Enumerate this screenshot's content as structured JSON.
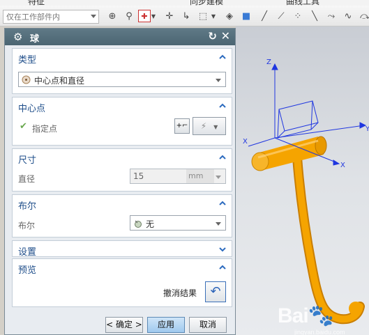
{
  "top_menu": {
    "left_label": "特征",
    "mid_label": "同步建模",
    "right_label": "曲线工具"
  },
  "toolbar": {
    "filter_select": "仅在工作部件内"
  },
  "dialog": {
    "title": "球",
    "sections": {
      "type": {
        "header": "类型",
        "selected": "中心点和直径"
      },
      "center": {
        "header": "中心点",
        "label": "指定点"
      },
      "size": {
        "header": "尺寸",
        "diameter_label": "直径",
        "diameter_value": "15",
        "unit": "mm"
      },
      "boolean": {
        "header": "布尔",
        "label": "布尔",
        "value": "无"
      },
      "settings": {
        "header": "设置"
      },
      "preview": {
        "header": "预览",
        "undo_label": "撤消结果"
      }
    },
    "buttons": {
      "ok": "< 确定 >",
      "apply": "应用",
      "cancel": "取消"
    }
  },
  "viewport": {
    "axis_labels": {
      "x1": "X",
      "y": "Y",
      "z": "Z",
      "x2": "X"
    },
    "model_color": "#f5a400"
  },
  "colors": {
    "section_header": "#1f4e8a",
    "title_bar": "#56707d",
    "accent": "#5d8ab5"
  }
}
